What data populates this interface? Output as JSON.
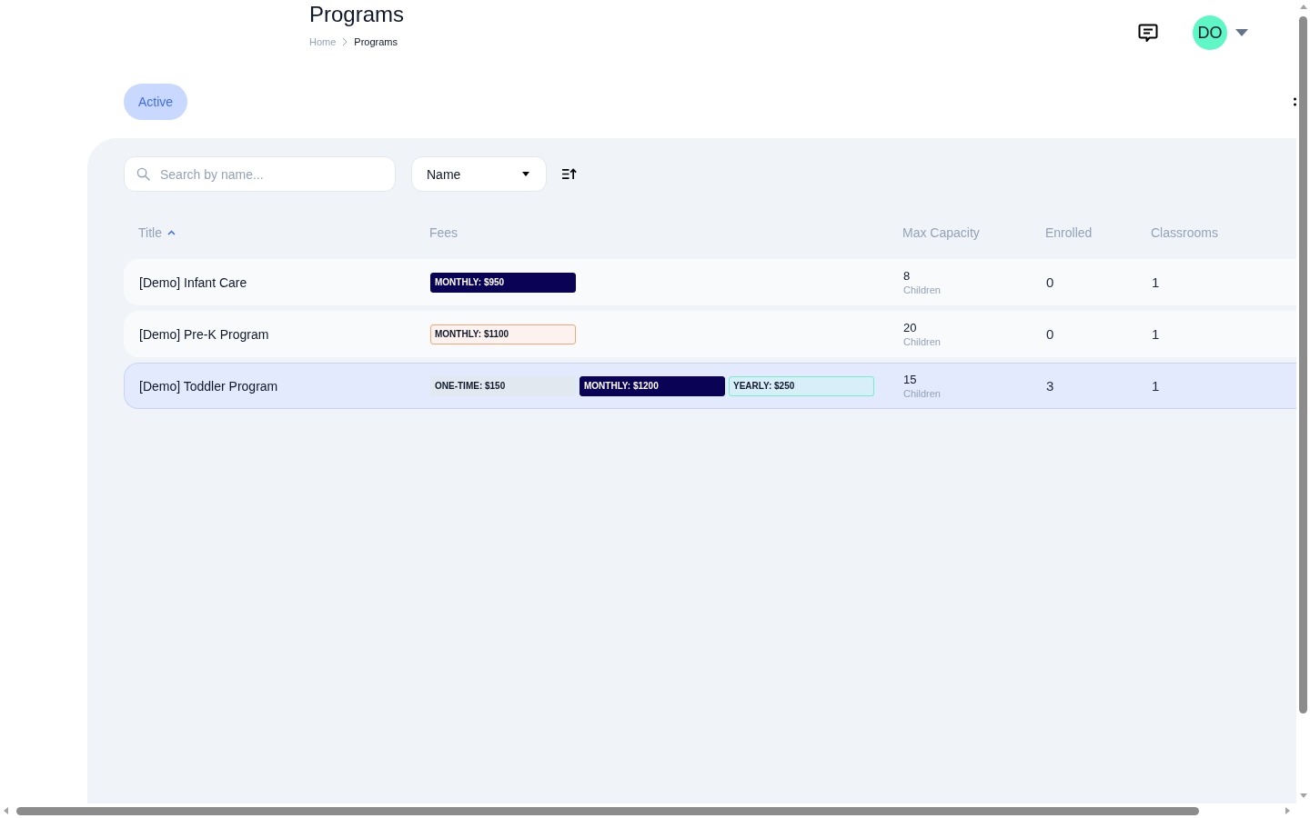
{
  "header": {
    "title": "Programs",
    "breadcrumb": [
      {
        "label": "Home",
        "current": false
      },
      {
        "label": "Programs",
        "current": true
      }
    ]
  },
  "user": {
    "initials": "DO"
  },
  "tabs": [
    {
      "label": "Active",
      "selected": true
    }
  ],
  "toolbar": {
    "search": {
      "placeholder": "Search by name..."
    },
    "sort_field": {
      "value": "Name"
    }
  },
  "table": {
    "columns": [
      {
        "label": "Title",
        "sorted": true
      },
      {
        "label": "Fees",
        "sorted": false
      },
      {
        "label": "Max Capacity",
        "sorted": false
      },
      {
        "label": "Enrolled",
        "sorted": false
      },
      {
        "label": "Classrooms",
        "sorted": false
      }
    ],
    "rows": [
      {
        "title": "[Demo] Infant Care",
        "fees": [
          {
            "label": "MONTHLY: $950",
            "kind": "solid",
            "color": "#0a0254"
          }
        ],
        "max_capacity": "8",
        "capacity_unit": "Children",
        "enrolled": "0",
        "classrooms": "1",
        "selected": false
      },
      {
        "title": "[Demo] Pre-K Program",
        "fees": [
          {
            "label": "MONTHLY: $1100",
            "kind": "peach",
            "color": "#f5a57a"
          }
        ],
        "max_capacity": "20",
        "capacity_unit": "Children",
        "enrolled": "0",
        "classrooms": "1",
        "selected": false
      },
      {
        "title": "[Demo] Toddler Program",
        "fees": [
          {
            "label": "ONE-TIME: $150",
            "kind": "soft",
            "color": "#e2e8f0"
          },
          {
            "label": "MONTHLY: $1200",
            "kind": "solid",
            "color": "#0a0254"
          },
          {
            "label": "YEARLY: $250",
            "kind": "sky",
            "color": "#6ff0c6"
          }
        ],
        "max_capacity": "15",
        "capacity_unit": "Children",
        "enrolled": "3",
        "classrooms": "1",
        "selected": true
      }
    ]
  }
}
